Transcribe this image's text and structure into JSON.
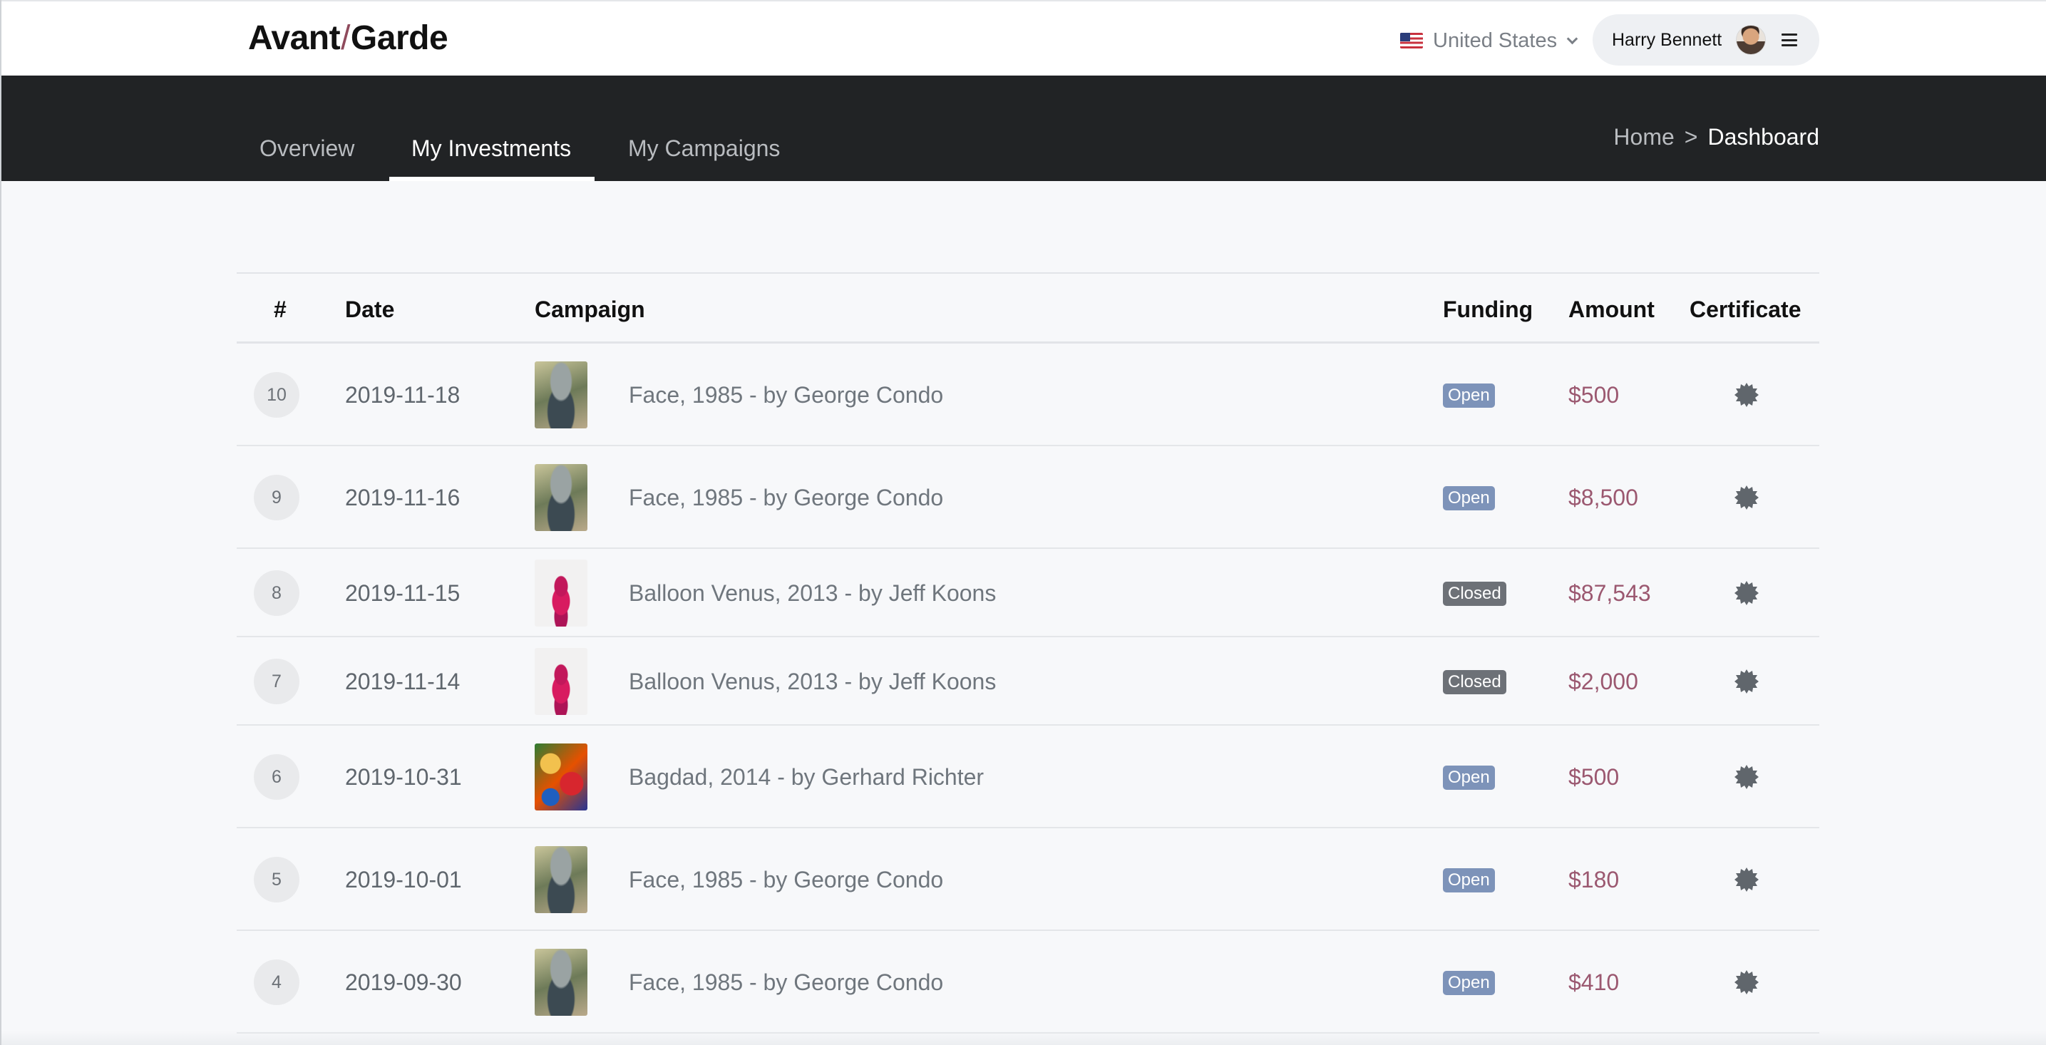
{
  "header": {
    "logo_left": "Avant",
    "logo_slash": "/",
    "logo_right": "Garde",
    "country": "United States",
    "country_icon": "us-flag-icon",
    "user_name": "Harry Bennett",
    "menu_icon": "hamburger-menu-icon"
  },
  "nav": {
    "tabs": [
      {
        "label": "Overview",
        "active": false
      },
      {
        "label": "My Investments",
        "active": true
      },
      {
        "label": "My Campaigns",
        "active": false
      }
    ],
    "breadcrumb": {
      "home": "Home",
      "separator": ">",
      "current": "Dashboard"
    }
  },
  "table": {
    "headers": {
      "num": "#",
      "date": "Date",
      "campaign": "Campaign",
      "funding": "Funding",
      "amount": "Amount",
      "certificate": "Certificate"
    },
    "rows": [
      {
        "num": "10",
        "date": "2019-11-18",
        "thumb": "condo",
        "campaign": "Face, 1985 - by George Condo",
        "funding": "Open",
        "amount": "$500"
      },
      {
        "num": "9",
        "date": "2019-11-16",
        "thumb": "condo",
        "campaign": "Face, 1985 - by George Condo",
        "funding": "Open",
        "amount": "$8,500"
      },
      {
        "num": "8",
        "date": "2019-11-15",
        "thumb": "koons",
        "campaign": "Balloon Venus, 2013 - by Jeff Koons",
        "funding": "Closed",
        "amount": "$87,543"
      },
      {
        "num": "7",
        "date": "2019-11-14",
        "thumb": "koons",
        "campaign": "Balloon Venus, 2013 - by Jeff Koons",
        "funding": "Closed",
        "amount": "$2,000"
      },
      {
        "num": "6",
        "date": "2019-10-31",
        "thumb": "richter",
        "campaign": "Bagdad, 2014 - by Gerhard Richter",
        "funding": "Open",
        "amount": "$500"
      },
      {
        "num": "5",
        "date": "2019-10-01",
        "thumb": "condo",
        "campaign": "Face, 1985 - by George Condo",
        "funding": "Open",
        "amount": "$180"
      },
      {
        "num": "4",
        "date": "2019-09-30",
        "thumb": "condo",
        "campaign": "Face, 1985 - by George Condo",
        "funding": "Open",
        "amount": "$410"
      }
    ],
    "certificate_icon": "certificate-seal-icon"
  },
  "colors": {
    "nav_bg": "#212325",
    "open_badge": "#7d93b9",
    "closed_badge": "#6d7177",
    "amount": "#9b5870",
    "logo_slash": "#8f4a5c"
  }
}
